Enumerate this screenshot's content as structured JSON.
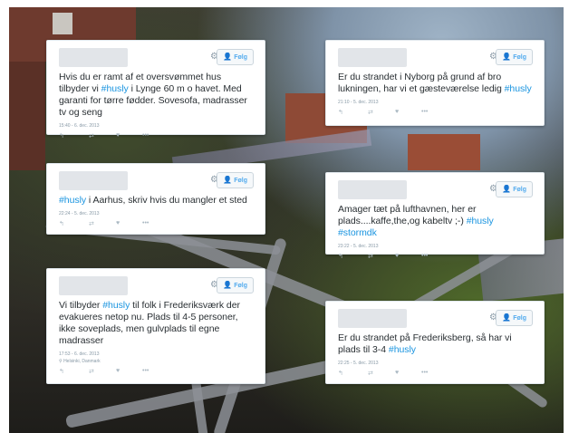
{
  "actions": {
    "reply_icon": "reply-icon",
    "retweet_icon": "retweet-icon",
    "like_icon": "heart-icon",
    "more_icon": "more-icon"
  },
  "tweets": [
    {
      "follow_label": "Følg",
      "segments": [
        {
          "text": "Hvis du er ramt af et oversvømmet hus tilbyder vi ",
          "tag": false
        },
        {
          "text": "#husly",
          "tag": true
        },
        {
          "text": " i Lynge 60 m o havet. Med garanti for tørre fødder. Sovesofa, madrasser  tv og seng",
          "tag": false
        }
      ],
      "time": "15:40 - 6. dec. 2013"
    },
    {
      "follow_label": "Følg",
      "segments": [
        {
          "text": "#husly",
          "tag": true
        },
        {
          "text": " i Aarhus, skriv hvis du mangler et sted",
          "tag": false
        }
      ],
      "time": "22:24 - 5. dec. 2013"
    },
    {
      "follow_label": "Følg",
      "segments": [
        {
          "text": "Vi tilbyder ",
          "tag": false
        },
        {
          "text": "#husly",
          "tag": true
        },
        {
          "text": " til folk i Frederiksværk der evakueres netop nu. Plads til 4-5 personer, ikke soveplads, men gulvplads til egne madrasser",
          "tag": false
        }
      ],
      "time": "17:53 - 6. dec. 2013",
      "location": "Helsinki, Danmark"
    },
    {
      "follow_label": "Følg",
      "segments": [
        {
          "text": "Er du strandet i Nyborg på grund af bro lukningen, har vi et gæsteværelse ledig ",
          "tag": false
        },
        {
          "text": "#husly",
          "tag": true
        }
      ],
      "time": "21:10 - 5. dec. 2013"
    },
    {
      "follow_label": "Følg",
      "segments": [
        {
          "text": "Amager tæt på lufthavnen, her er plads....kaffe,the,og kabeltv ;-) ",
          "tag": false
        },
        {
          "text": "#husly",
          "tag": true
        },
        {
          "text": " ",
          "tag": false
        },
        {
          "text": "#stormdk",
          "tag": true
        }
      ],
      "time": "23:22 - 5. dec. 2013"
    },
    {
      "follow_label": "Følg",
      "segments": [
        {
          "text": "Er du strandet på Frederiksberg, så har vi plads til 3-4 ",
          "tag": false
        },
        {
          "text": "#husly",
          "tag": true
        }
      ],
      "time": "22:25 - 5. dec. 2013"
    }
  ]
}
